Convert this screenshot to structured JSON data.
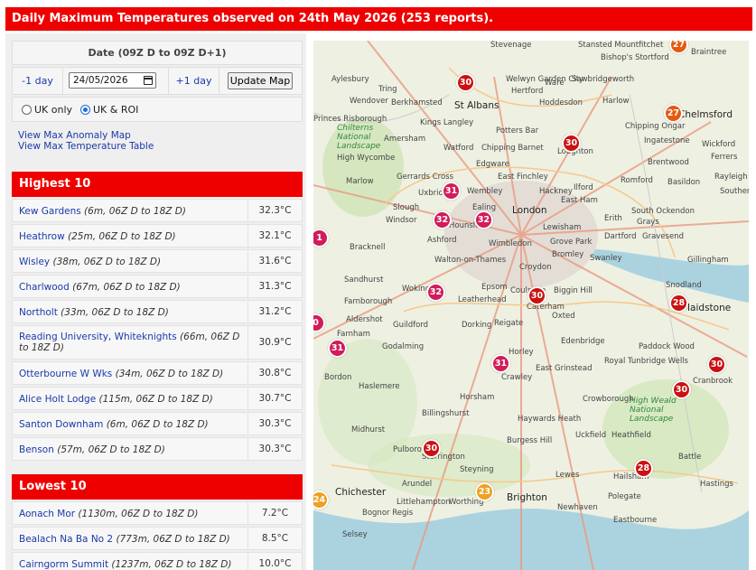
{
  "page_title": "Daily Maximum Temperatures observed on 24th May 2026 (253 reports).",
  "controls": {
    "date_heading": "Date (09Z D to 09Z D+1)",
    "prev_day": "-1 day",
    "date_value": "24/05/2026",
    "next_day": "+1 day",
    "update_button": "Update Map",
    "region_options": [
      {
        "label": "UK only",
        "selected": false
      },
      {
        "label": "UK & ROI",
        "selected": true
      }
    ],
    "links": [
      "View Max Anomaly Map",
      "View Max Temperature Table"
    ]
  },
  "highest": {
    "heading": "Highest 10",
    "rows": [
      {
        "station": "Kew Gardens",
        "meta": "(6m, 06Z D to 18Z D)",
        "value": "32.3°C"
      },
      {
        "station": "Heathrow",
        "meta": "(25m, 06Z D to 18Z D)",
        "value": "32.1°C"
      },
      {
        "station": "Wisley",
        "meta": "(38m, 06Z D to 18Z D)",
        "value": "31.6°C"
      },
      {
        "station": "Charlwood",
        "meta": "(67m, 06Z D to 18Z D)",
        "value": "31.3°C"
      },
      {
        "station": "Northolt",
        "meta": "(33m, 06Z D to 18Z D)",
        "value": "31.2°C"
      },
      {
        "station": "Reading University, Whiteknights",
        "meta": "(66m, 06Z D to 18Z D)",
        "value": "30.9°C"
      },
      {
        "station": "Otterbourne W Wks",
        "meta": "(34m, 06Z D to 18Z D)",
        "value": "30.8°C"
      },
      {
        "station": "Alice Holt Lodge",
        "meta": "(115m, 06Z D to 18Z D)",
        "value": "30.7°C"
      },
      {
        "station": "Santon Downham",
        "meta": "(6m, 06Z D to 18Z D)",
        "value": "30.3°C"
      },
      {
        "station": "Benson",
        "meta": "(57m, 06Z D to 18Z D)",
        "value": "30.3°C"
      }
    ]
  },
  "lowest": {
    "heading": "Lowest 10",
    "rows": [
      {
        "station": "Aonach Mor",
        "meta": "(1130m, 06Z D to 18Z D)",
        "value": "7.2°C"
      },
      {
        "station": "Bealach Na Ba No 2",
        "meta": "(773m, 06Z D to 18Z D)",
        "value": "8.5°C"
      },
      {
        "station": "Cairngorm Summit",
        "meta": "(1237m, 06Z D to 18Z D)",
        "value": "10.0°C"
      }
    ]
  },
  "map": {
    "markers": [
      {
        "value": "27",
        "color": "o"
      },
      {
        "value": "30",
        "color": "r"
      },
      {
        "value": "27",
        "color": "o"
      },
      {
        "value": "30",
        "color": "r"
      },
      {
        "value": "31",
        "color": "m"
      },
      {
        "value": "32",
        "color": "m"
      },
      {
        "value": "32",
        "color": "m"
      },
      {
        "value": "1",
        "color": "m"
      },
      {
        "value": "32",
        "color": "m"
      },
      {
        "value": "30",
        "color": "r"
      },
      {
        "value": "28",
        "color": "r"
      },
      {
        "value": "0",
        "color": "m"
      },
      {
        "value": "31",
        "color": "m"
      },
      {
        "value": "31",
        "color": "m"
      },
      {
        "value": "30",
        "color": "r"
      },
      {
        "value": "30",
        "color": "r"
      },
      {
        "value": "30",
        "color": "r"
      },
      {
        "value": "28",
        "color": "r"
      },
      {
        "value": "24",
        "color": "y"
      },
      {
        "value": "23",
        "color": "y"
      }
    ],
    "places": [
      "Stevenage",
      "Stansted Mountfitchet",
      "Braintree",
      "Bishop's Stortford",
      "Aylesbury",
      "Welwyn Garden City",
      "Ware",
      "Sawbridgeworth",
      "Tring",
      "Hertford",
      "Berkhamsted",
      "St Albans",
      "Hoddesdon",
      "Wendover",
      "Harlow",
      "Kings Langley",
      "Chipping Ongar",
      "Princes Risborough",
      "Chilterns National Landscape",
      "Amersham",
      "Potters Bar",
      "Ingatestone",
      "Chelmsford",
      "Loughton",
      "Wickford",
      "Ferrers",
      "High Wycombe",
      "Watford",
      "Chipping Barnet",
      "Brentwood",
      "Edgware",
      "Marlow",
      "Gerrards Cross",
      "East Finchley",
      "Romford",
      "Basildon",
      "Rayleigh",
      "Wembley",
      "Uxbridge",
      "Hackney",
      "Southend",
      "Ilford",
      "Slough",
      "London",
      "East Ham",
      "Windsor",
      "Hounslow",
      "Ealing",
      "South Ockendon",
      "Erith",
      "Grays",
      "Bracknell",
      "Ashford",
      "Wimbledon",
      "Lewisham",
      "Grove Park",
      "Dartford",
      "Gravesend",
      "Bromley",
      "Swanley",
      "Gillingham",
      "Sandhurst",
      "Walton-on-Thames",
      "Croydon",
      "Epsom",
      "Woking",
      "Leatherhead",
      "Coulsdon",
      "Biggin Hill",
      "Maidstone",
      "Farnborough",
      "Caterham",
      "Oxted",
      "Aldershot",
      "Guildford",
      "Dorking",
      "Reigate",
      "Snodland",
      "Farnham",
      "Godalming",
      "Edenbridge",
      "Paddock Wood",
      "Horley",
      "Bordon",
      "Haslemere",
      "Crawley",
      "East Grinstead",
      "Royal Tunbridge Wells",
      "Cranbrook",
      "Horsham",
      "Crowborough",
      "High Weald National Landscape",
      "Midhurst",
      "Billingshurst",
      "Haywards Heath",
      "Uckfield",
      "Heathfield",
      "Pulborough",
      "Burgess Hill",
      "Storrington",
      "Battle",
      "Steyning",
      "Lewes",
      "Hailsham",
      "Chichester",
      "Arundel",
      "Worthing",
      "Brighton",
      "Polegate",
      "Hastings",
      "Littlehampton",
      "Newhaven",
      "Bognor Regis",
      "Eastbourne",
      "Selsey"
    ]
  }
}
